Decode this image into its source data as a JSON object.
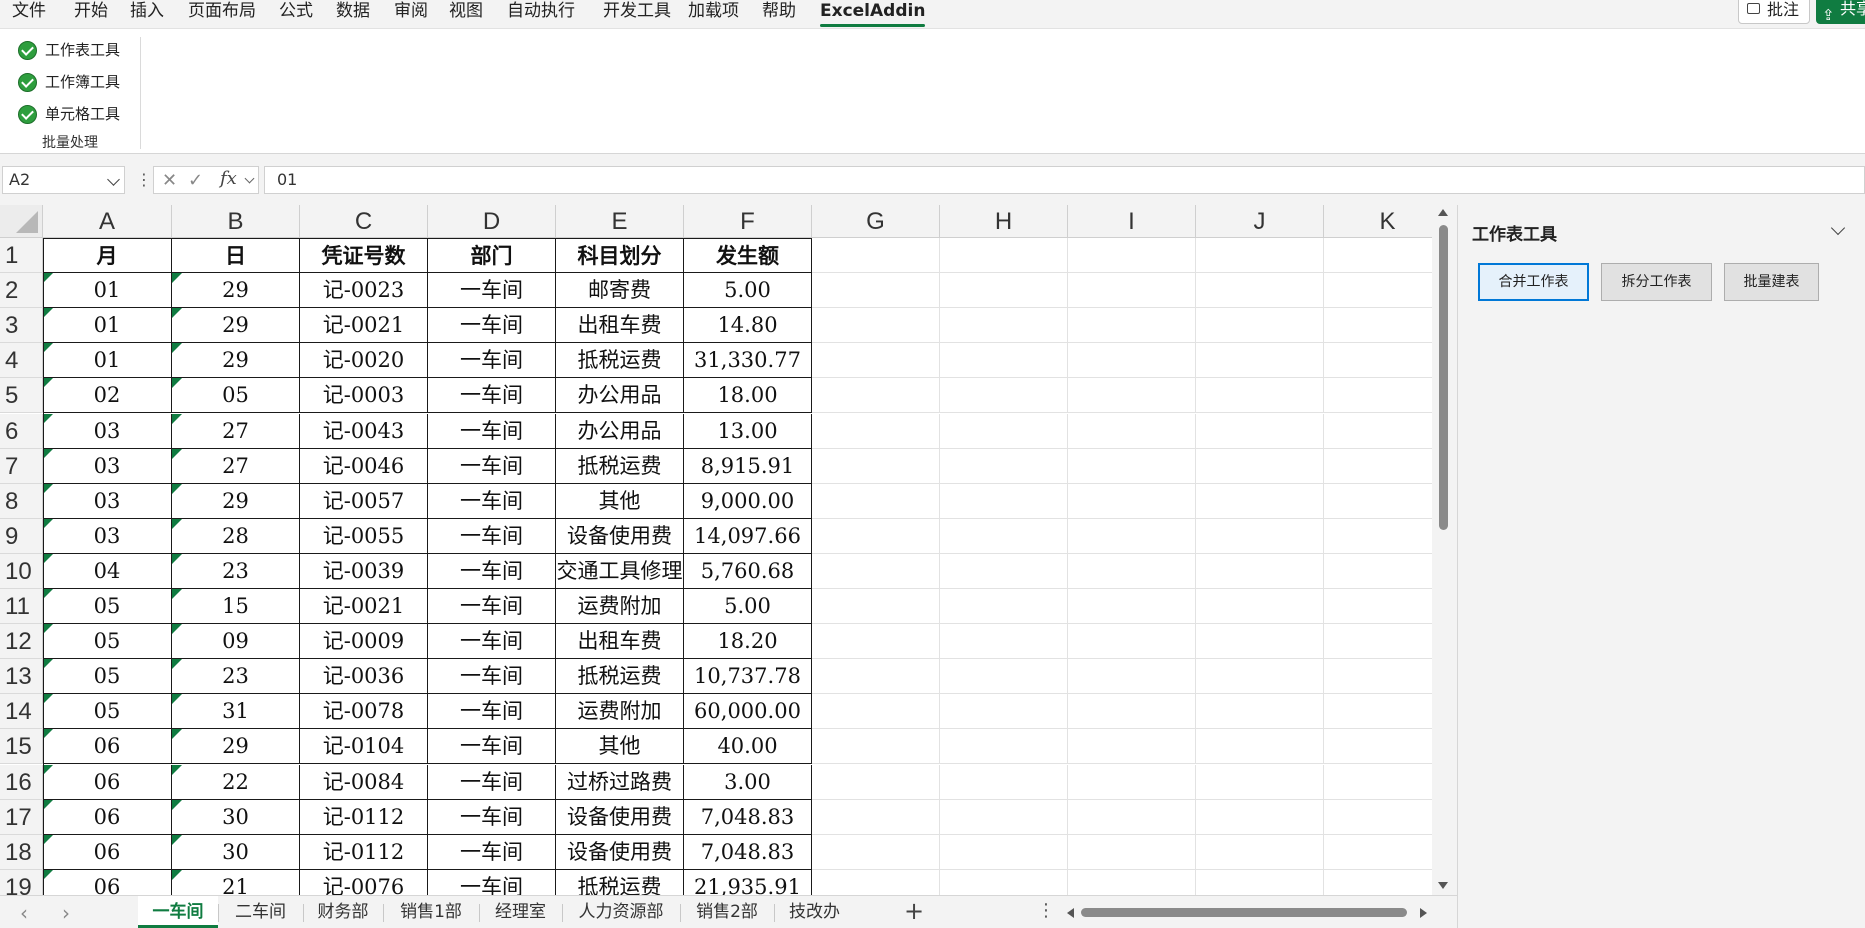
{
  "menu": {
    "items": [
      "文件",
      "开始",
      "插入",
      "页面布局",
      "公式",
      "数据",
      "审阅",
      "视图",
      "自动执行",
      "开发工具",
      "加载项",
      "帮助",
      "ExcelAddin"
    ],
    "active": "ExcelAddin",
    "comment_label": "批注",
    "share_label": "共享"
  },
  "ribbon": {
    "buttons": [
      "工作表工具",
      "工作簿工具",
      "单元格工具"
    ],
    "group_label": "批量处理"
  },
  "formula_bar": {
    "name_box": "A2",
    "fx": "fx",
    "value": "01"
  },
  "grid": {
    "columns": [
      "A",
      "B",
      "C",
      "D",
      "E",
      "F",
      "G",
      "H",
      "I",
      "J",
      "K"
    ],
    "row_numbers": [
      "1",
      "2",
      "3",
      "4",
      "5",
      "6",
      "7",
      "8",
      "9",
      "10",
      "11",
      "12",
      "13",
      "14",
      "15",
      "16",
      "17",
      "18",
      "19"
    ],
    "header_row": [
      "月",
      "日",
      "凭证号数",
      "部门",
      "科目划分",
      "发生额"
    ],
    "rows": [
      [
        "01",
        "29",
        "记-0023",
        "一车间",
        "邮寄费",
        "5.00"
      ],
      [
        "01",
        "29",
        "记-0021",
        "一车间",
        "出租车费",
        "14.80"
      ],
      [
        "01",
        "29",
        "记-0020",
        "一车间",
        "抵税运费",
        "31,330.77"
      ],
      [
        "02",
        "05",
        "记-0003",
        "一车间",
        "办公用品",
        "18.00"
      ],
      [
        "03",
        "27",
        "记-0043",
        "一车间",
        "办公用品",
        "13.00"
      ],
      [
        "03",
        "27",
        "记-0046",
        "一车间",
        "抵税运费",
        "8,915.91"
      ],
      [
        "03",
        "29",
        "记-0057",
        "一车间",
        "其他",
        "9,000.00"
      ],
      [
        "03",
        "28",
        "记-0055",
        "一车间",
        "设备使用费",
        "14,097.66"
      ],
      [
        "04",
        "23",
        "记-0039",
        "一车间",
        "交通工具修理",
        "5,760.68"
      ],
      [
        "05",
        "15",
        "记-0021",
        "一车间",
        "运费附加",
        "5.00"
      ],
      [
        "05",
        "09",
        "记-0009",
        "一车间",
        "出租车费",
        "18.20"
      ],
      [
        "05",
        "23",
        "记-0036",
        "一车间",
        "抵税运费",
        "10,737.78"
      ],
      [
        "05",
        "31",
        "记-0078",
        "一车间",
        "运费附加",
        "60,000.00"
      ],
      [
        "06",
        "29",
        "记-0104",
        "一车间",
        "其他",
        "40.00"
      ],
      [
        "06",
        "22",
        "记-0084",
        "一车间",
        "过桥过路费",
        "3.00"
      ],
      [
        "06",
        "30",
        "记-0112",
        "一车间",
        "设备使用费",
        "7,048.83"
      ],
      [
        "06",
        "30",
        "记-0112",
        "一车间",
        "设备使用费",
        "7,048.83"
      ],
      [
        "06",
        "21",
        "记-0076",
        "一车间",
        "抵税运费",
        "21,935.91"
      ]
    ]
  },
  "task_pane": {
    "title": "工作表工具",
    "buttons": [
      "合并工作表",
      "拆分工作表",
      "批量建表"
    ]
  },
  "sheets": {
    "tabs": [
      "一车间",
      "二车间",
      "财务部",
      "销售1部",
      "经理室",
      "人力资源部",
      "销售2部",
      "技改办"
    ],
    "active": "一车间",
    "add_label": "+",
    "more_label": "⋮"
  },
  "colors": {
    "accent": "#107c41",
    "focus": "#0078d7"
  }
}
